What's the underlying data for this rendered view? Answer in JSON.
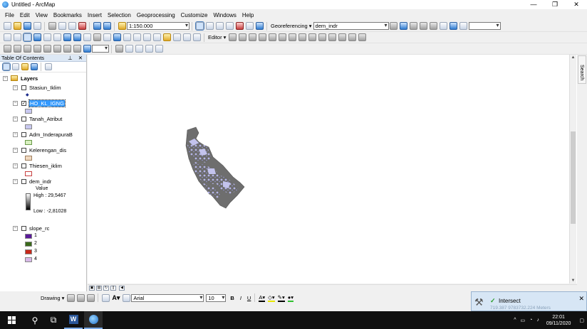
{
  "window": {
    "title": "Untitled - ArcMap",
    "controls": [
      "—",
      "❐",
      "✕"
    ]
  },
  "menu": [
    "File",
    "Edit",
    "View",
    "Bookmarks",
    "Insert",
    "Selection",
    "Geoprocessing",
    "Customize",
    "Windows",
    "Help"
  ],
  "toolbar": {
    "scale": "1:150.000",
    "georeferencing_label": "Georeferencing ▾",
    "georef_layer": "dem_indr",
    "editor_label": "Editor ▾"
  },
  "toc": {
    "title": "Table Of Contents",
    "header_controls": "⊥ ✕",
    "root": "Layers",
    "layers": [
      {
        "name": "Stasiun_Iklim",
        "checked": false
      },
      {
        "name": "HO_KL_IGNG",
        "checked": true
      },
      {
        "name": "Tanah_Atribut",
        "checked": false
      },
      {
        "name": "Adm_InderapuraB",
        "checked": false
      },
      {
        "name": "Kelerengan_dis",
        "checked": false
      },
      {
        "name": "Thiesen_iklim",
        "checked": false
      },
      {
        "name": "dem_indr",
        "checked": false
      },
      {
        "name": "slope_rc",
        "checked": false
      }
    ],
    "dem_legend": {
      "value_label": "Value",
      "high": "High : 29,5467",
      "low": "Low : -2,81028"
    },
    "slope_classes": [
      "1",
      "2",
      "3",
      "4"
    ],
    "colors": {
      "stasiun_point": "#1a2a8a",
      "ho_kl": "#c8c8f0",
      "tanah": "#c8c8f0",
      "adm": "#d8f0c0",
      "kelerengan": "#f0d8c0",
      "thiesen": "#f4c8c8",
      "slope_1": "#5a1a9a",
      "slope_2": "#3a6a1a",
      "slope_3": "#c8281a",
      "slope_4": "#d8b8e8"
    }
  },
  "search_tab": "Search",
  "drawing": {
    "drawing_label": "Drawing ▾",
    "font_name": "Arial",
    "font_size": "10",
    "bold": "B",
    "italic": "I",
    "underline": "U"
  },
  "notification": {
    "title": "Intersect",
    "coords": "719.387  9783732.224 Meters"
  },
  "taskbar": {
    "time": "22:01",
    "date": "09/11/2020"
  }
}
